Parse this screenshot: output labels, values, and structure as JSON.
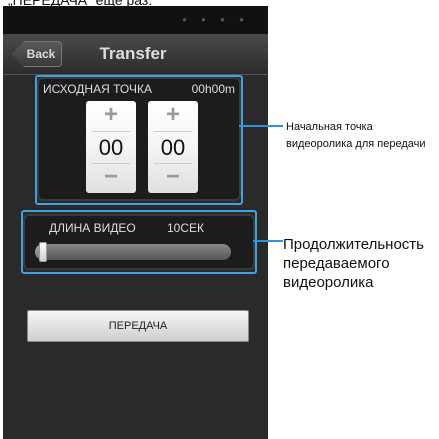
{
  "header_text": "„ПЕРЕДАЧА“ еще раз.",
  "screen": {
    "back_label": "Back",
    "title": "Transfer",
    "start_point": {
      "label": "ИСХОДНАЯ ТОЧКА",
      "value": "00h00m",
      "spinners": [
        {
          "plus": "+",
          "value": "00",
          "minus": "−"
        },
        {
          "plus": "+",
          "value": "00",
          "minus": "−"
        }
      ]
    },
    "video_length": {
      "label": "ДЛИНА ВИДЕО",
      "value": "10СЕК",
      "slider_fraction": 0.0
    },
    "transfer_button": "ПЕРЕДАЧА"
  },
  "callouts": {
    "start_point_lines": [
      "Начальная точка",
      "видеоролика для передачи"
    ],
    "length_lines": [
      "Продолжительность",
      "передаваемого",
      "видеоролика"
    ]
  },
  "colors": {
    "highlight": "#3aa3e0",
    "callout_line": "#2d95d9",
    "background": "#2a2a2a"
  }
}
